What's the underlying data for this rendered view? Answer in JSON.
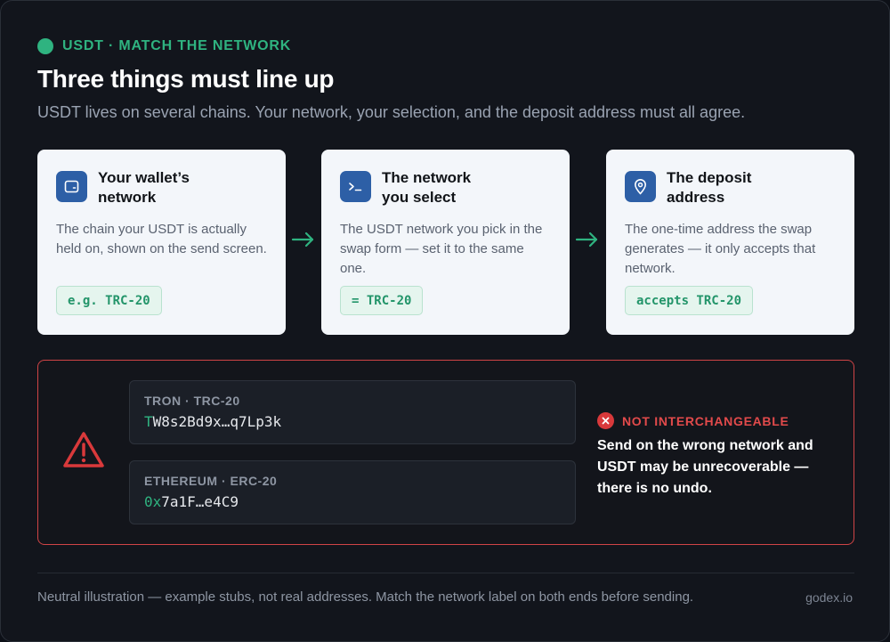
{
  "eyebrow": "USDT · MATCH THE NETWORK",
  "title": "Three things must line up",
  "subtitle": "USDT lives on several chains. Your network, your selection, and the deposit address must all agree.",
  "cards": [
    {
      "icon": "wallet-icon",
      "title_line1": "Your wallet’s",
      "title_line2": "network",
      "desc": "The chain your USDT is actually held on, shown on the send screen.",
      "tag": "e.g. TRC-20"
    },
    {
      "icon": "terminal-icon",
      "title_line1": "The network",
      "title_line2": "you select",
      "desc": "The USDT network you pick in the swap form — set it to the same one.",
      "tag": "= TRC-20"
    },
    {
      "icon": "location-pin-icon",
      "title_line1": "The deposit",
      "title_line2": "address",
      "desc": "The one-time address the swap generates — it only accepts that network.",
      "tag": "accepts TRC-20"
    }
  ],
  "addresses": [
    {
      "network": "TRON · TRC-20",
      "prefix": "T",
      "rest": "W8s2Bd9x…q7Lp3k"
    },
    {
      "network": "ETHEREUM · ERC-20",
      "prefix": "0x",
      "rest": "7a1F…e4C9"
    }
  ],
  "warning": {
    "label": "NOT INTERCHANGEABLE",
    "text": "Send on the wrong network and USDT may be unrecoverable — there is no undo."
  },
  "footer": {
    "note": "Neutral illustration — example stubs, not real addresses. Match the network label on both ends before sending.",
    "brand": "godex.io"
  },
  "colors": {
    "accent_green": "#2fb380",
    "danger_red": "#d9393b",
    "icon_blue": "#2d5fa6"
  }
}
